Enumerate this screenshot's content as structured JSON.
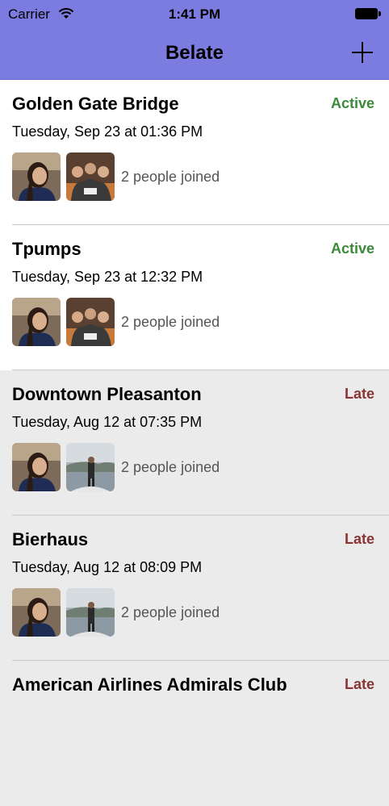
{
  "status_bar": {
    "carrier": "Carrier",
    "time": "1:41 PM"
  },
  "nav": {
    "title": "Belate",
    "add_icon": "plus-icon"
  },
  "colors": {
    "nav_bg": "#7b7be0",
    "active": "#3a8a3a",
    "late": "#8a3434"
  },
  "events": [
    {
      "title": "Golden Gate Bridge",
      "status": "Active",
      "date": "Tuesday, Sep 23 at 01:36 PM",
      "joined": "2 people joined"
    },
    {
      "title": "Tpumps",
      "status": "Active",
      "date": "Tuesday, Sep 23 at 12:32 PM",
      "joined": "2 people joined"
    },
    {
      "title": "Downtown Pleasanton",
      "status": "Late",
      "date": "Tuesday, Aug 12 at 07:35 PM",
      "joined": "2 people joined"
    },
    {
      "title": "Bierhaus",
      "status": "Late",
      "date": "Tuesday, Aug 12 at 08:09 PM",
      "joined": "2 people joined"
    },
    {
      "title": "American Airlines Admirals Club",
      "status": "Late",
      "date": "",
      "joined": ""
    }
  ]
}
